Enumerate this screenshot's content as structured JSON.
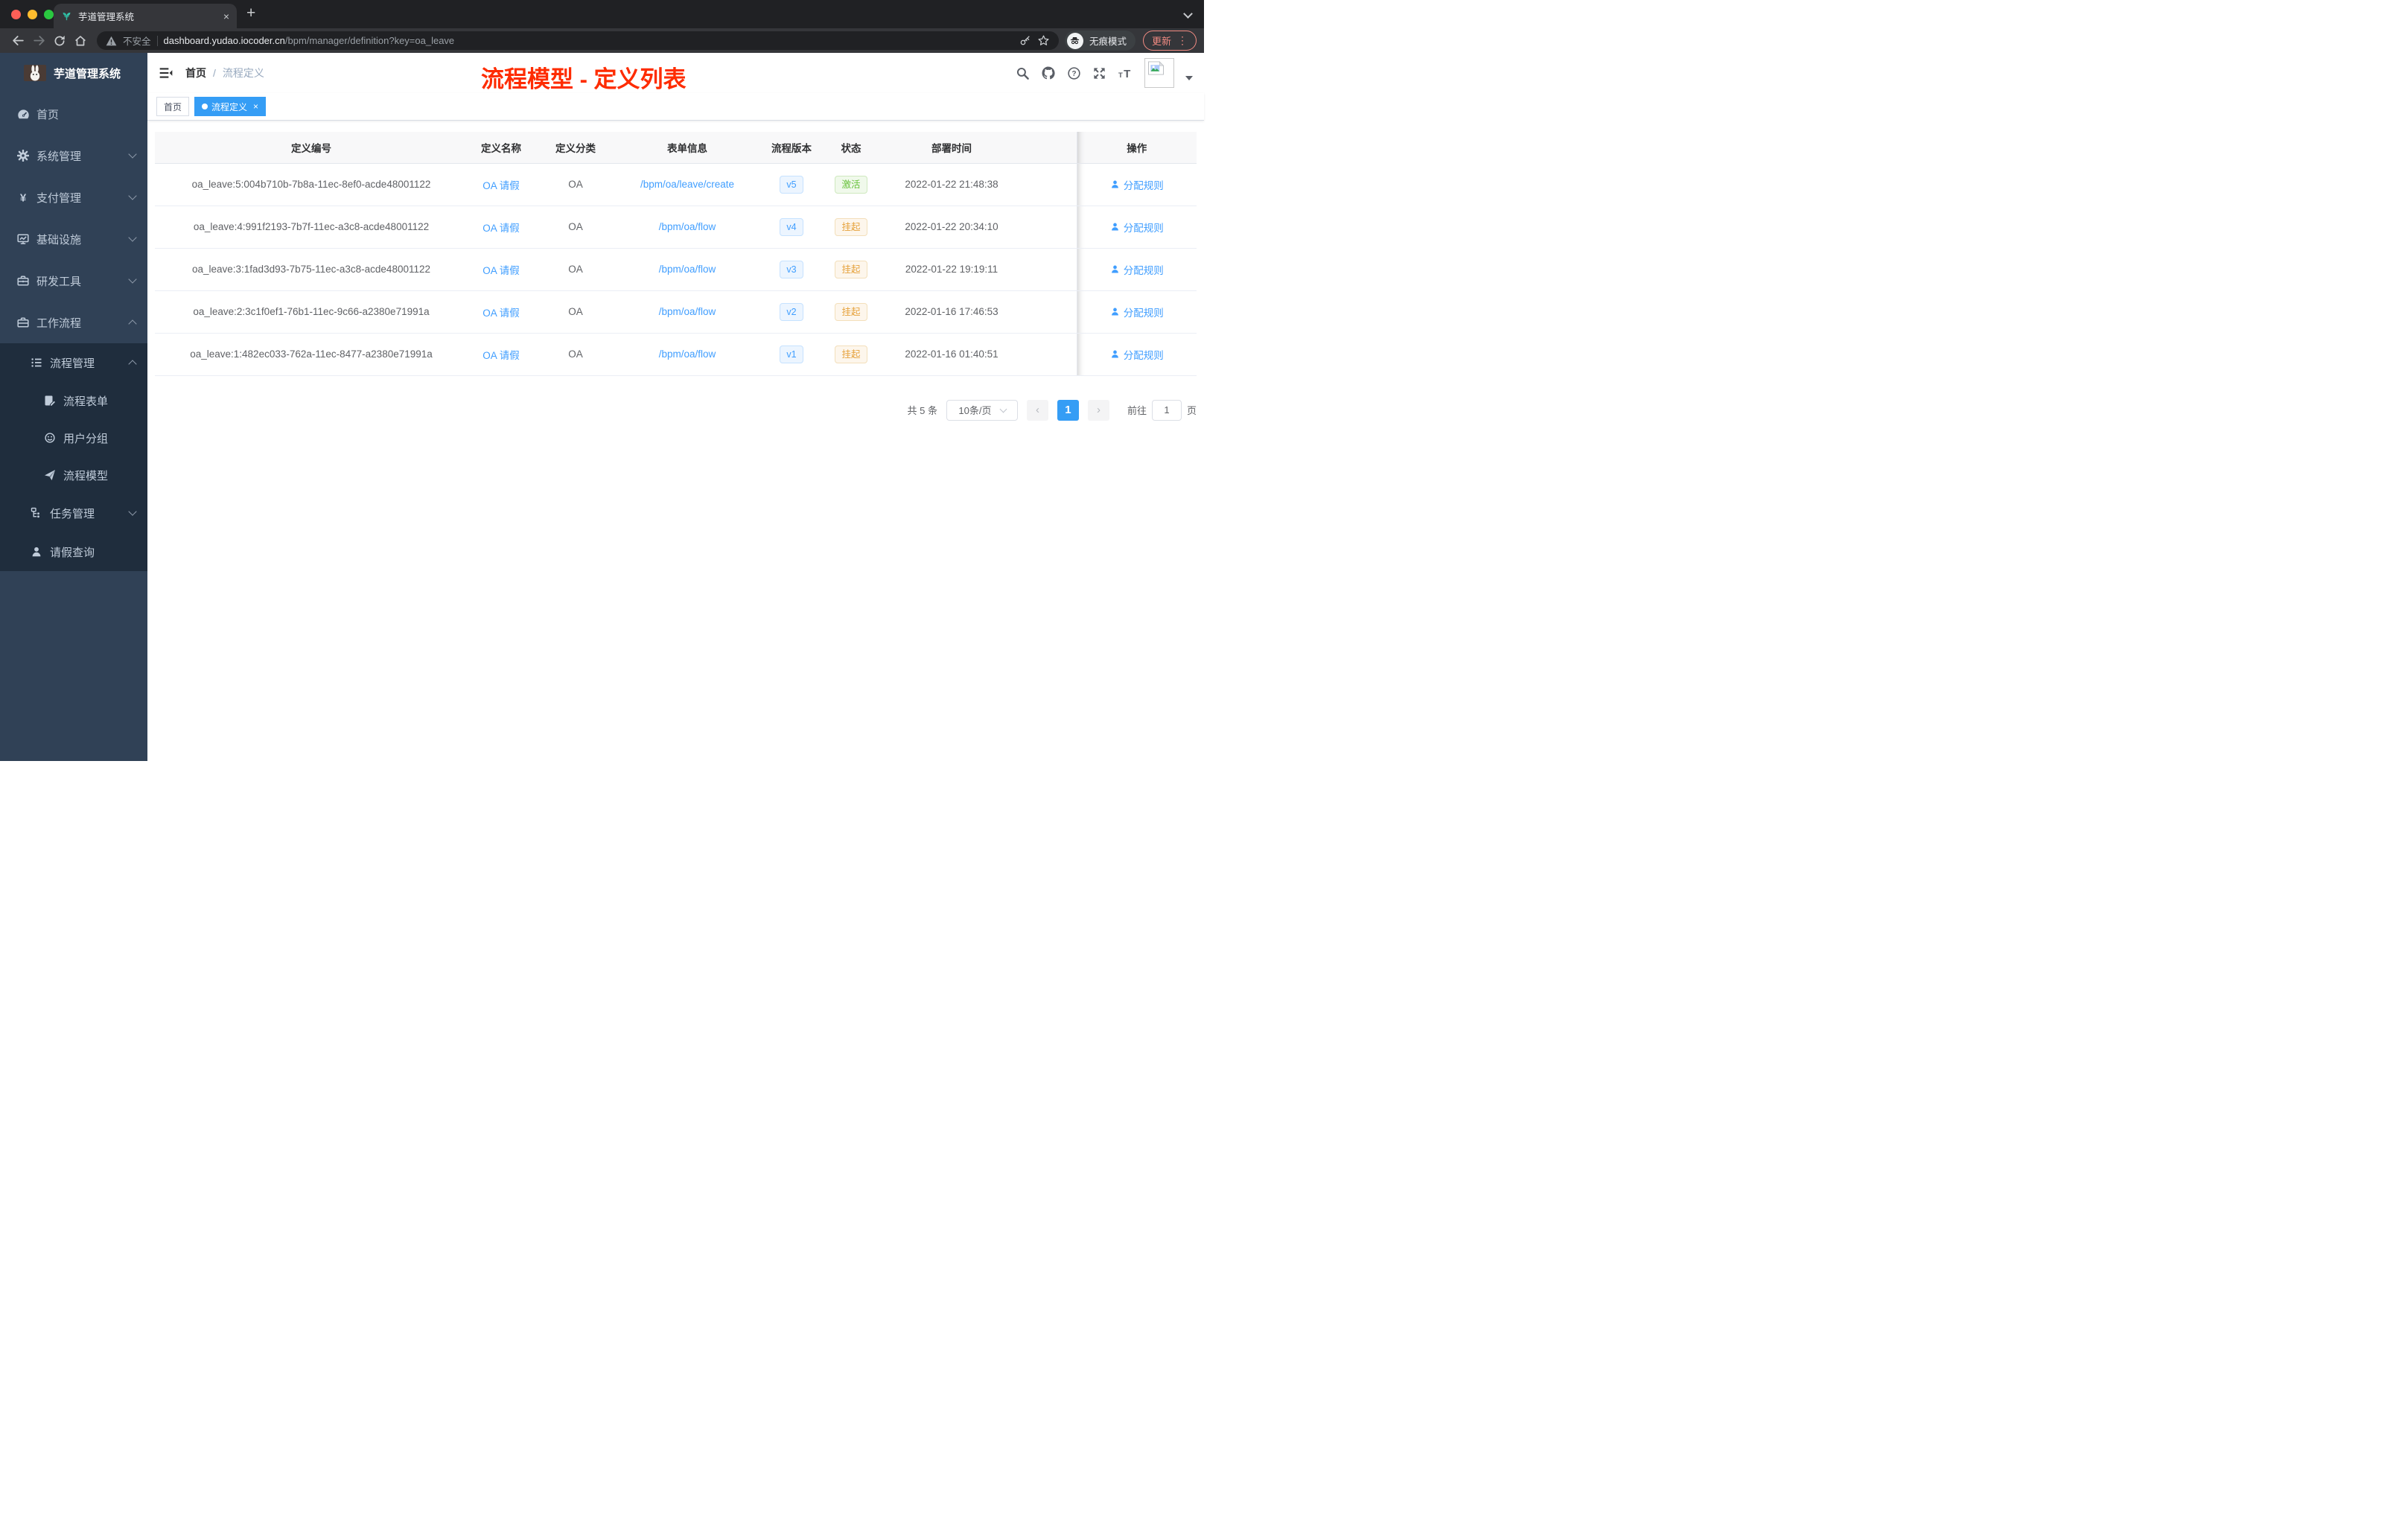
{
  "browser": {
    "tab_title": "芋道管理系统",
    "close_tab": "×",
    "new_tab": "+",
    "security_label": "不安全",
    "url_host": "dashboard.yudao.iocoder.cn",
    "url_path": "/bpm/manager/definition?key=oa_leave",
    "incognito_label": "无痕模式",
    "update_label": "更新",
    "menu_dots": "⋮"
  },
  "sidebar": {
    "logo_title": "芋道管理系统",
    "items": [
      {
        "label": "首页",
        "icon": "dashboard-icon",
        "level": 1
      },
      {
        "label": "系统管理",
        "icon": "gear-icon",
        "level": 1,
        "chevron": "down"
      },
      {
        "label": "支付管理",
        "icon": "yen-icon",
        "level": 1,
        "chevron": "down"
      },
      {
        "label": "基础设施",
        "icon": "monitor-icon",
        "level": 1,
        "chevron": "down"
      },
      {
        "label": "研发工具",
        "icon": "toolbox-icon",
        "level": 1,
        "chevron": "down"
      },
      {
        "label": "工作流程",
        "icon": "briefcase-icon",
        "level": 1,
        "chevron": "up"
      },
      {
        "label": "流程管理",
        "icon": "list-icon",
        "level": 2,
        "chevron": "up",
        "sub": true
      },
      {
        "label": "流程表单",
        "icon": "form-icon",
        "level": 3,
        "sub": true
      },
      {
        "label": "用户分组",
        "icon": "user-group-icon",
        "level": 3,
        "sub": true
      },
      {
        "label": "流程模型",
        "icon": "paper-plane-icon",
        "level": 3,
        "sub": true
      },
      {
        "label": "任务管理",
        "icon": "tree-icon",
        "level": 2,
        "chevron": "down",
        "sub": true
      },
      {
        "label": "请假查询",
        "icon": "person-icon",
        "level": 2,
        "sub": true
      }
    ]
  },
  "navbar": {
    "breadcrumb": [
      "首页",
      "流程定义"
    ],
    "separator": "/",
    "annotation": "流程模型 - 定义列表",
    "icon_names": [
      "search-icon",
      "github-icon",
      "help-icon",
      "fullscreen-icon",
      "font-size-icon"
    ]
  },
  "tags": [
    {
      "label": "首页",
      "active": false
    },
    {
      "label": "流程定义",
      "active": true
    }
  ],
  "table": {
    "columns": [
      "定义编号",
      "定义名称",
      "定义分类",
      "表单信息",
      "流程版本",
      "状态",
      "部署时间",
      "操作"
    ],
    "rows": [
      {
        "id": "oa_leave:5:004b710b-7b8a-11ec-8ef0-acde48001122",
        "name": "OA 请假",
        "category": "OA",
        "form": "/bpm/oa/leave/create",
        "version": "v5",
        "status": "激活",
        "status_type": "success",
        "time": "2022-01-22 21:48:38",
        "action": "分配规则"
      },
      {
        "id": "oa_leave:4:991f2193-7b7f-11ec-a3c8-acde48001122",
        "name": "OA 请假",
        "category": "OA",
        "form": "/bpm/oa/flow",
        "version": "v4",
        "status": "挂起",
        "status_type": "warning",
        "time": "2022-01-22 20:34:10",
        "action": "分配规则"
      },
      {
        "id": "oa_leave:3:1fad3d93-7b75-11ec-a3c8-acde48001122",
        "name": "OA 请假",
        "category": "OA",
        "form": "/bpm/oa/flow",
        "version": "v3",
        "status": "挂起",
        "status_type": "warning",
        "time": "2022-01-22 19:19:11",
        "action": "分配规则"
      },
      {
        "id": "oa_leave:2:3c1f0ef1-76b1-11ec-9c66-a2380e71991a",
        "name": "OA 请假",
        "category": "OA",
        "form": "/bpm/oa/flow",
        "version": "v2",
        "status": "挂起",
        "status_type": "warning",
        "time": "2022-01-16 17:46:53",
        "action": "分配规则"
      },
      {
        "id": "oa_leave:1:482ec033-762a-11ec-8477-a2380e71991a",
        "name": "OA 请假",
        "category": "OA",
        "form": "/bpm/oa/flow",
        "version": "v1",
        "status": "挂起",
        "status_type": "warning",
        "time": "2022-01-16 01:40:51",
        "action": "分配规则"
      }
    ]
  },
  "pagination": {
    "total": "共 5 条",
    "page_size": "10条/页",
    "prev": "‹",
    "current": "1",
    "next": "›",
    "goto_label": "前往",
    "goto_value": "1",
    "goto_suffix": "页"
  },
  "colors": {
    "accent": "#409eff",
    "tag_active": "#359df5",
    "success": "#67c23a",
    "warning": "#e6a23c",
    "annotation": "#fe2c00",
    "sidebar_bg": "#304156",
    "submenu_bg": "#1f2d3d"
  }
}
